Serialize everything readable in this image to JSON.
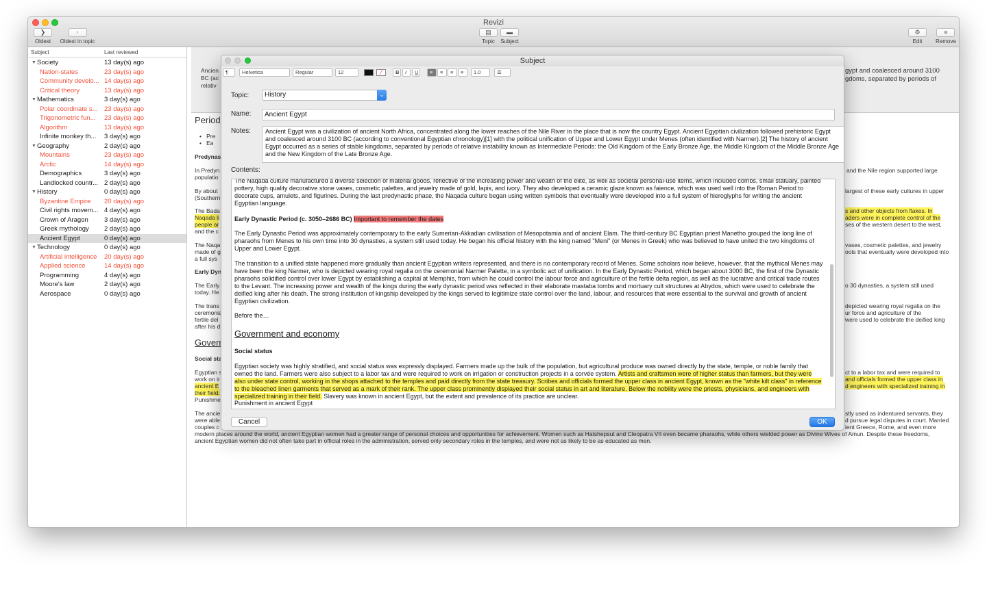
{
  "window": {
    "title": "Revizi",
    "toolbar": {
      "oldest": "Oldest",
      "oldest_in_topic": "Oldest in topic",
      "topic": "Topic",
      "subject": "Subject",
      "edit": "Edit",
      "remove": "Remove"
    }
  },
  "sidebar": {
    "col_subject": "Subject",
    "col_last_reviewed": "Last reviewed",
    "rows": [
      {
        "name": "Society",
        "reviewed": "13 day(s) ago",
        "group": true,
        "overdue": false
      },
      {
        "name": "Nation-states",
        "reviewed": "23 day(s) ago",
        "group": false,
        "overdue": true
      },
      {
        "name": "Community develo...",
        "reviewed": "14 day(s) ago",
        "group": false,
        "overdue": true
      },
      {
        "name": "Critical theory",
        "reviewed": "13 day(s) ago",
        "group": false,
        "overdue": true
      },
      {
        "name": "Mathematics",
        "reviewed": "3 day(s) ago",
        "group": true,
        "overdue": false
      },
      {
        "name": "Polar coordinate s...",
        "reviewed": "23 day(s) ago",
        "group": false,
        "overdue": true
      },
      {
        "name": "Trigonometric fun...",
        "reviewed": "23 day(s) ago",
        "group": false,
        "overdue": true
      },
      {
        "name": "Algorithm",
        "reviewed": "13 day(s) ago",
        "group": false,
        "overdue": true
      },
      {
        "name": "Infinite monkey th...",
        "reviewed": "3 day(s) ago",
        "group": false,
        "overdue": false
      },
      {
        "name": "Geography",
        "reviewed": "2 day(s) ago",
        "group": true,
        "overdue": false
      },
      {
        "name": "Mountains",
        "reviewed": "23 day(s) ago",
        "group": false,
        "overdue": true
      },
      {
        "name": "Arctic",
        "reviewed": "14 day(s) ago",
        "group": false,
        "overdue": true
      },
      {
        "name": "Demographics",
        "reviewed": "3 day(s) ago",
        "group": false,
        "overdue": false
      },
      {
        "name": "Landlocked countr...",
        "reviewed": "2 day(s) ago",
        "group": false,
        "overdue": false
      },
      {
        "name": "History",
        "reviewed": "0 day(s) ago",
        "group": true,
        "overdue": false
      },
      {
        "name": "Byzantine Empire",
        "reviewed": "20 day(s) ago",
        "group": false,
        "overdue": true
      },
      {
        "name": "Civil rights movem...",
        "reviewed": "4 day(s) ago",
        "group": false,
        "overdue": false
      },
      {
        "name": "Crown of Aragon",
        "reviewed": "3 day(s) ago",
        "group": false,
        "overdue": false
      },
      {
        "name": "Greek mythology",
        "reviewed": "2 day(s) ago",
        "group": false,
        "overdue": false
      },
      {
        "name": "Ancient Egypt",
        "reviewed": "0 day(s) ago",
        "group": false,
        "overdue": false,
        "selected": true
      },
      {
        "name": "Technology",
        "reviewed": "0 day(s) ago",
        "group": true,
        "overdue": false
      },
      {
        "name": "Artificial intelligence",
        "reviewed": "20 day(s) ago",
        "group": false,
        "overdue": true
      },
      {
        "name": "Applied science",
        "reviewed": "14 day(s) ago",
        "group": false,
        "overdue": true
      },
      {
        "name": "Programming",
        "reviewed": "4 day(s) ago",
        "group": false,
        "overdue": false
      },
      {
        "name": "Moore's law",
        "reviewed": "2 day(s) ago",
        "group": false,
        "overdue": false
      },
      {
        "name": "Aerospace",
        "reviewed": "0 day(s) ago",
        "group": false,
        "overdue": false
      }
    ]
  },
  "background": {
    "notes_left": "Ancien",
    "notes_left2": "BC (ac",
    "notes_left3": "relativ",
    "notes_right1": "gypt and coalesced around 3100",
    "notes_right2": "gdoms, separated by periods of",
    "heading_periods": "Period",
    "bullet1": "Pre",
    "bullet2": "Ea",
    "predynastic": "Predynas",
    "p1a": "In Predyn",
    "p1b": "populatio",
    "p2a": "By about",
    "p2b": "(Southern",
    "p3a": "The Bada",
    "p3b": "Naqada li",
    "p3c": "people ar",
    "p3d": "and the c",
    "p4a": "The Naqa",
    "p4b": "made of g",
    "p4c": "a full sys",
    "early_dyn": "Early Dyn",
    "p5a": "The Early",
    "p5b": "today. He",
    "p6a": "The trans",
    "p6b": "ceremonia",
    "p6c": "fertile del",
    "p6d": "after his d",
    "heading_gov": "Govern",
    "social": "Social sta",
    "p7a": "Egyptian s",
    "p7b": "work on ir",
    "p7c": "ancient E",
    "p7d": "their field.",
    "p7e": "Punishme",
    "p8a": "The ancie",
    "p8b": "were able",
    "p8c": "couples c",
    "p8d": "modern places around the world, ancient Egyptian women had a greater range of personal choices and opportunities for achievement. Women such as Hatshepsut and Cleopatra VII even became pharaohs, while others wielded power as Divine Wives of Amun. Despite these freedoms,",
    "p8e": "ancient Egyptian women did not often take part in official roles in the administration, served only secondary roles in the temples, and were not as likely to be as educated as men.",
    "r1": "and the Nile region supported large",
    "r2": "largest of these early cultures in upper",
    "r3a": "s and other objects from flakes. In",
    "r3b": "aders were in complete control of the",
    "r3c": "ses of the western desert to the west,",
    "r4a": "vases, cosmetic palettes, and jewelry",
    "r4b": "ools that eventually were developed into",
    "r5": "o 30 dynasties, a system still used",
    "r6a": "depicted wearing royal regalia on the",
    "r6b": "ur force and agriculture of the",
    "r6c": "were used to celebrate the deified king",
    "r7a": "ct to a labor tax and were required to",
    "r7b": "and officials formed the upper class in",
    "r7c": "d engineers with specialized training in",
    "r8a": "stly used as indentured servants, they",
    "r8b": "d pursue legal disputes in court. Married",
    "r8c": "ient Greece, Rome, and even more"
  },
  "dialog": {
    "title": "Subject",
    "format": {
      "paragraph": "¶",
      "font": "Helvetica",
      "style": "Regular",
      "size": "12",
      "bold": "B",
      "italic": "I",
      "underline": "U",
      "spacing": "1.0"
    },
    "topic_label": "Topic:",
    "topic_value": "History",
    "name_label": "Name:",
    "name_value": "Ancient Egypt",
    "notes_label": "Notes:",
    "notes_value": "Ancient Egypt was a civilization of ancient North Africa, concentrated along the lower reaches of the Nile River in the place that is now the country Egypt. Ancient Egyptian civilization followed prehistoric Egypt and coalesced around 3100 BC (according to conventional Egyptian chronology)[1] with the political unification of Upper and Lower Egypt under Menes (often identified with Narmer).[2] The history of ancient Egypt occurred as a series of stable kingdoms, separated by periods of relative instability known as Intermediate Periods: the Old Kingdom of the Early Bronze Age, the Middle Kingdom of the Middle Bronze Age and the New Kingdom of the Late Bronze Age.",
    "contents_label": "Contents:",
    "contents": {
      "p0": "The Naqada culture manufactured a diverse selection of material goods, reflective of the increasing power and wealth of the elite, as well as societal personal-use items, which included combs, small statuary, painted pottery, high quality decorative stone vases, cosmetic palettes, and jewelry made of gold, lapis, and ivory. They also developed a ceramic glaze known as faience, which was used well into the Roman Period to decorate cups, amulets, and figurines. During the last predynastic phase, the Naqada culture began using written symbols that eventually were developed into a full system of hieroglyphs for writing the ancient Egyptian language.",
      "h_early": "Early Dynastic Period (c. 3050–2686 BC)",
      "h_early_note": "Important to remember the dates",
      "p1": "The Early Dynastic Period was approximately contemporary to the early Sumerian-Akkadian civilisation of Mesopotamia and of ancient Elam. The third-century BC Egyptian priest Manetho grouped the long line of pharaohs from Menes to his own time into 30 dynasties, a system still used today. He began his official history with the king named \"Meni\" (or Menes in Greek) who was believed to have united the two kingdoms of Upper and Lower Egypt.",
      "p2": "The transition to a unified state happened more gradually than ancient Egyptian writers represented, and there is no contemporary record of Menes. Some scholars now believe, however, that the mythical Menes may have been the king Narmer, who is depicted wearing royal regalia on the ceremonial Narmer Palette, in a symbolic act of unification. In the Early Dynastic Period, which began about 3000 BC, the first of the Dynastic pharaohs solidified control over lower Egypt by establishing a capital at Memphis, from which he could control the labour force and agriculture of the fertile delta region, as well as the lucrative and critical trade routes to the Levant. The increasing power and wealth of the kings during the early dynastic period was reflected in their elaborate mastaba tombs and mortuary cult structures at Abydos, which were used to celebrate the deified king after his death. The strong institution of kingship developed by the kings served to legitimize state control over the land, labour, and resources that were essential to the survival and growth of ancient Egyptian civilization.",
      "p3": "Before the…",
      "h_gov": "Government and economy",
      "h_social": "Social status",
      "p4a": "Egyptian society was highly stratified, and social status was expressly displayed. Farmers made up the bulk of the population, but agricultural produce was owned directly by the state, temple, or noble family that owned the land. Farmers were also subject to a labor tax and were required to work on irrigation or construction projects in a corvée system.",
      "p4b": "Artists and craftsmen were of higher status than farmers, but they were also under state control, working in the shops attached to the temples and paid directly from the state treasury. Scribes and officials formed the upper class in ancient Egypt, known as the \"white kilt class\" in reference to the bleached linen garments that served as a mark of their rank. The upper class prominently displayed their social status in art and literature. Below the nobility were the priests, physicians, and engineers with specialized training in their field.",
      "p4c": " Slavery was known in ancient Egypt, but the extent and prevalence of its practice are unclear.",
      "p5": "Punishment in ancient Egypt"
    },
    "cancel": "Cancel",
    "ok": "OK"
  }
}
